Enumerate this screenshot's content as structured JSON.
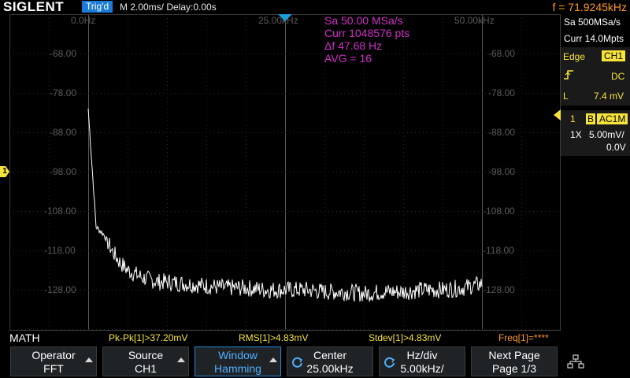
{
  "header": {
    "brand": "SIGLENT",
    "trig_status": "Trig'd",
    "timebase": "M 2.00ms/ Delay:0.00s",
    "frequency": "f = 71.9245kHz"
  },
  "grid": {
    "freq_labels": [
      "0.0Hz",
      "25.00kHz",
      "50.00kHz"
    ],
    "db_labels_left": [
      "-68.00",
      "-78.00",
      "-88.00",
      "-98.00",
      "-108.00",
      "-118.00",
      "-128.00"
    ],
    "db_labels_right": [
      "-68.00",
      "-78.00",
      "-88.00",
      "-98.00",
      "-108.00",
      "-118.00",
      "-128.00"
    ],
    "channel_marker": "1",
    "trace_color": "#ffffff"
  },
  "fft_info": {
    "sample_rate": "Sa 50.00 MSa/s",
    "points": "Curr 1048576 pts",
    "delta_f": "Δf 47.68 Hz",
    "average": "AVG = 16"
  },
  "right_panel": {
    "sample_rate": "Sa 500MSa/s",
    "memory": "Curr 14.0Mpts",
    "trigger_type": "Edge",
    "trigger_source": "CH1",
    "coupling": "DC",
    "level_label": "L",
    "level_value": "7.4 mV",
    "ch_number": "1",
    "bw_badge": "B",
    "ch_coupling": "AC1M",
    "probe": "1X",
    "volts_div": "5.00mV/",
    "offset": "0.0V"
  },
  "measurements": {
    "math_label": "MATH",
    "pkpk": "Pk-Pk[1]>37.20mV",
    "rms": "RMS[1]>4.83mV",
    "stdev": "Stdev[1]>4.83mV",
    "freq": "Freq[1]=****"
  },
  "softkeys": [
    {
      "title": "Operator",
      "value": "FFT"
    },
    {
      "title": "Source",
      "value": "CH1"
    },
    {
      "title": "Window",
      "value": "Hamming"
    },
    {
      "title": "Center",
      "value": "25.00kHz"
    },
    {
      "title": "Hz/div",
      "value": "5.00kHz/"
    },
    {
      "title": "Next Page",
      "value": "Page 1/3"
    }
  ],
  "chart_data": {
    "type": "line",
    "title": "",
    "xlabel": "",
    "ylabel": "",
    "xlim": [
      0,
      50000
    ],
    "ylim": [
      -58,
      -138
    ],
    "x_unit": "Hz",
    "y_unit": "dB",
    "series": [
      {
        "x": [
          0,
          1000,
          2000,
          3000,
          4000,
          5000,
          6000,
          7000,
          8000,
          9000,
          10000,
          12500,
          15000,
          17500,
          20000,
          22500,
          25000,
          27500,
          30000,
          32500,
          35000,
          37500,
          40000,
          42500,
          45000,
          47500,
          50000
        ],
        "y": [
          -82,
          -112,
          -114,
          -118,
          -121,
          -123,
          -124,
          -125,
          -125.5,
          -126,
          -126,
          -126.5,
          -127,
          -127.5,
          -127.5,
          -128,
          -128,
          -128,
          -128.5,
          -128.5,
          -129,
          -128.5,
          -128.5,
          -128,
          -128,
          -127.5,
          -126.5
        ]
      }
    ]
  }
}
